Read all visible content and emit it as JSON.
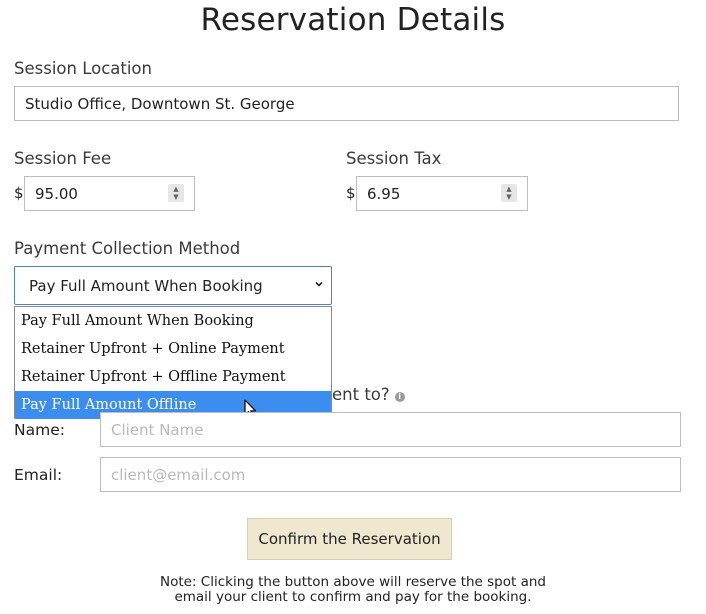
{
  "page_title": "Reservation Details",
  "session_location": {
    "label": "Session Location",
    "value": "Studio Office, Downtown St. George"
  },
  "session_fee": {
    "label": "Session Fee",
    "currency": "$",
    "value": "95.00"
  },
  "session_tax": {
    "label": "Session Tax",
    "currency": "$",
    "value": "6.95"
  },
  "payment": {
    "label": "Payment Collection Method",
    "selected": "Pay Full Amount When Booking",
    "options": [
      "Pay Full Amount When Booking",
      "Retainer Upfront + Online Payment",
      "Retainer Upfront + Offline Payment",
      "Pay Full Amount Offline"
    ],
    "highlighted_index": 3
  },
  "send_to": {
    "label_partial": "ent to?"
  },
  "client_name": {
    "label": "Name:",
    "placeholder": "Client Name"
  },
  "client_email": {
    "label": "Email:",
    "placeholder": "client@email.com"
  },
  "confirm_button": {
    "label": "Confirm the Reservation"
  },
  "note": {
    "line1": "Note: Clicking the button above will reserve the spot and",
    "line2": "email your client to confirm and pay for the booking."
  }
}
